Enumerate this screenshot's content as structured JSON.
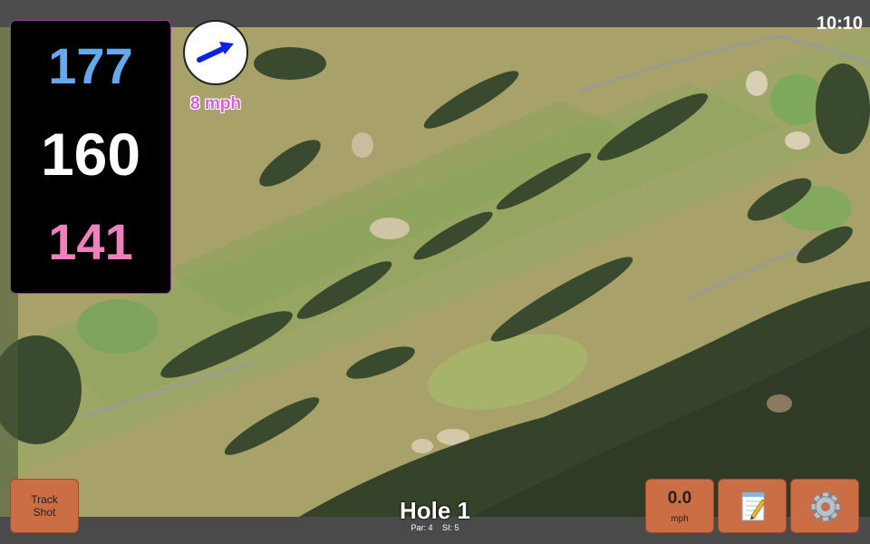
{
  "status": {
    "time": "10:10"
  },
  "yardages": {
    "back": "177",
    "center": "160",
    "front": "141"
  },
  "wind": {
    "speed": "8 mph",
    "direction_icon": "wind-arrow-icon"
  },
  "buttons": {
    "track_shot": {
      "line1": "Track",
      "line2": "Shot"
    },
    "speed": {
      "value": "0.0",
      "unit": "mph"
    },
    "notes_icon": "notes-icon",
    "settings_icon": "gear-icon"
  },
  "hole": {
    "title": "Hole 1",
    "par": "Par: 4",
    "si": "SI: 5"
  },
  "colors": {
    "back": "#64a8ee",
    "center": "#ffffff",
    "front": "#f07fbd",
    "button": "#cb6e45",
    "wind_text": "#d85fd8"
  }
}
